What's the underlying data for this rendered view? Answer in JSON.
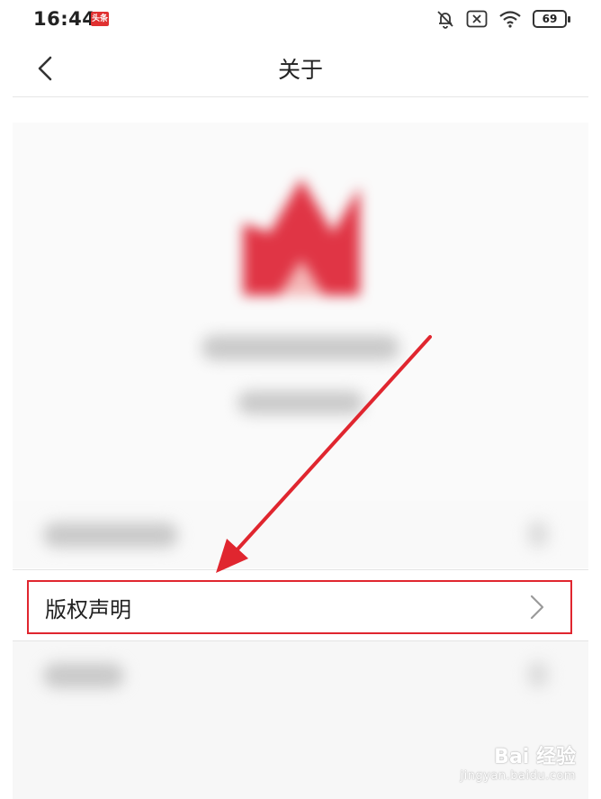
{
  "statusbar": {
    "time": "16:44",
    "app_badge": "头条",
    "battery": "69",
    "icons": [
      "bell-off-icon",
      "close-box-icon",
      "wifi-icon",
      "battery-icon"
    ]
  },
  "nav": {
    "title": "关于",
    "back_icon": "chevron-left-icon"
  },
  "rows": [
    {
      "label": "版权声明",
      "highlighted": true,
      "icon": "chevron-right-icon"
    }
  ],
  "annotation": {
    "arrow_color": "#e0262f",
    "highlight_color": "#e0262f"
  },
  "watermark": {
    "brand": "Bai 经验",
    "url": "jingyan.baidu.com"
  }
}
